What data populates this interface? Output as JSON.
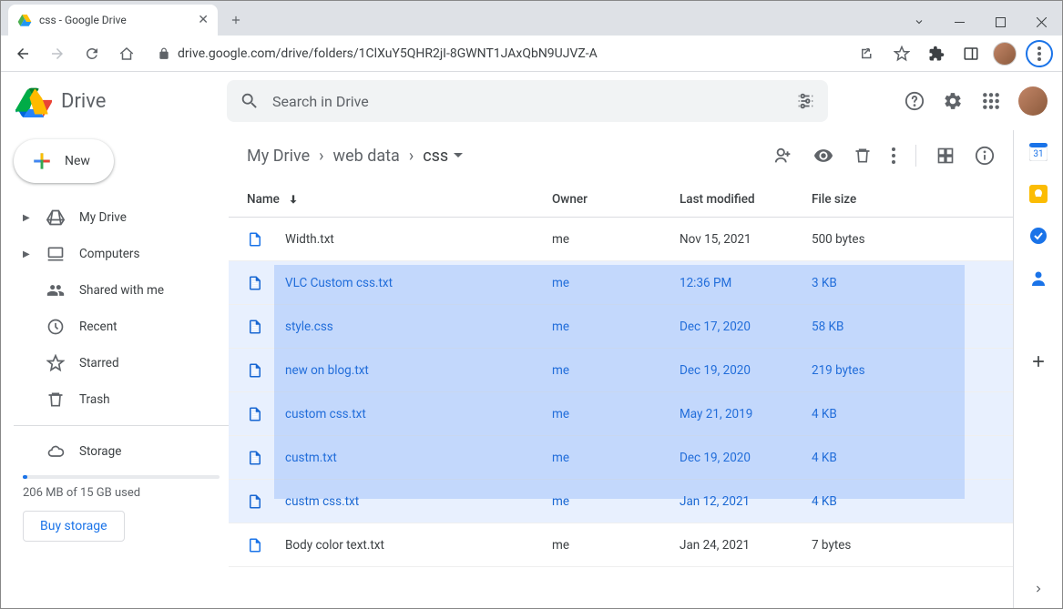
{
  "browser": {
    "tab_title": "css - Google Drive",
    "url": "drive.google.com/drive/folders/1ClXuY5QHR2jI-8GWNT1JAxQbN9UJVZ-A"
  },
  "header": {
    "product": "Drive",
    "search_placeholder": "Search in Drive"
  },
  "sidebar": {
    "new_label": "New",
    "items": [
      {
        "label": "My Drive"
      },
      {
        "label": "Computers"
      },
      {
        "label": "Shared with me"
      },
      {
        "label": "Recent"
      },
      {
        "label": "Starred"
      },
      {
        "label": "Trash"
      }
    ],
    "storage_label": "Storage",
    "storage_used": "206 MB of 15 GB used",
    "buy_label": "Buy storage"
  },
  "breadcrumb": {
    "root": "My Drive",
    "mid": "web data",
    "current": "css"
  },
  "columns": {
    "name": "Name",
    "owner": "Owner",
    "modified": "Last modified",
    "size": "File size"
  },
  "files": [
    {
      "name": "Width.txt",
      "owner": "me",
      "modified": "Nov 15, 2021",
      "size": "500 bytes",
      "selected": false
    },
    {
      "name": "VLC Custom css.txt",
      "owner": "me",
      "modified": "12:36 PM",
      "size": "3 KB",
      "selected": true
    },
    {
      "name": "style.css",
      "owner": "me",
      "modified": "Dec 17, 2020",
      "size": "58 KB",
      "selected": true
    },
    {
      "name": "new on blog.txt",
      "owner": "me",
      "modified": "Dec 19, 2020",
      "size": "219 bytes",
      "selected": true
    },
    {
      "name": "custom css.txt",
      "owner": "me",
      "modified": "May 21, 2019",
      "size": "4 KB",
      "selected": true
    },
    {
      "name": "custm.txt",
      "owner": "me",
      "modified": "Dec 19, 2020",
      "size": "4 KB",
      "selected": true
    },
    {
      "name": "custm css.txt",
      "owner": "me",
      "modified": "Jan 12, 2021",
      "size": "4 KB",
      "selected": true
    },
    {
      "name": "Body color text.txt",
      "owner": "me",
      "modified": "Jan 24, 2021",
      "size": "7 bytes",
      "selected": false
    }
  ]
}
